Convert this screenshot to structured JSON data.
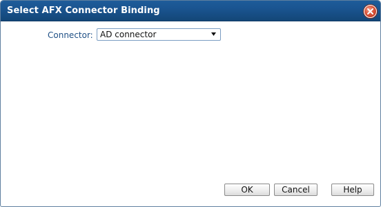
{
  "dialog": {
    "title": "Select AFX Connector Binding",
    "close_icon": "close-icon"
  },
  "form": {
    "connector_label": "Connector:",
    "connector_value": "AD connector",
    "dropdown_icon": "chevron-down-icon"
  },
  "buttons": {
    "ok_label": "OK",
    "cancel_label": "Cancel",
    "help_label": "Help"
  },
  "colors": {
    "titlebar": "#1a5490",
    "label_text": "#1e4f85",
    "close_button": "#d9553a"
  }
}
